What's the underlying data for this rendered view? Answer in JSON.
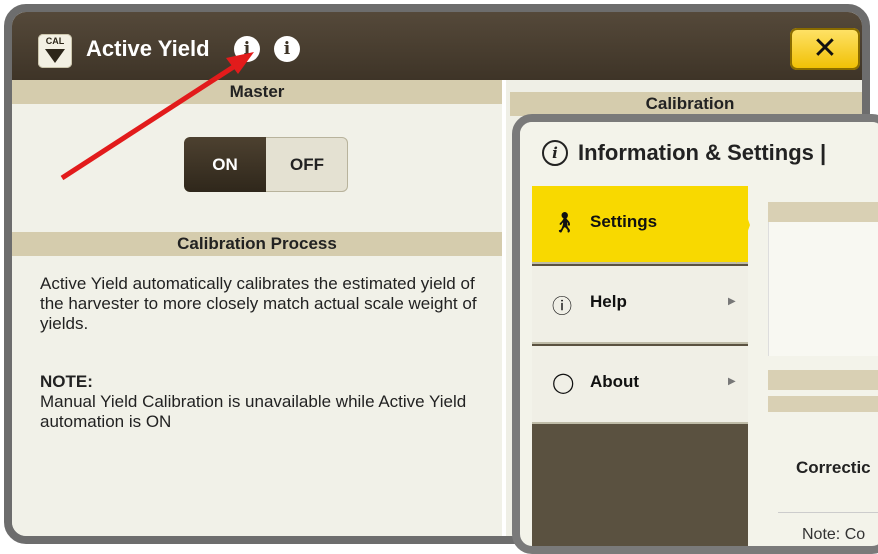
{
  "window": {
    "title": "Active Yield",
    "close_label": "✕",
    "cal_icon_text": "CAL"
  },
  "sections": {
    "master": "Master",
    "calibration": "Calibration",
    "calibration_process": "Calibration Process"
  },
  "toggle": {
    "on_label": "ON",
    "off_label": "OFF",
    "selected": "ON"
  },
  "calibration_process": {
    "description": "Active Yield automatically calibrates the estimated yield of the harvester to more closely match actual scale weight of yields.",
    "note_label": "NOTE:",
    "note_text": "Manual Yield Calibration is unavailable while Active Yield automation is ON"
  },
  "popup": {
    "title": "Information & Settings |",
    "nav": [
      {
        "label": "Settings",
        "icon": "person-icon",
        "active": true
      },
      {
        "label": "Help",
        "icon": "question-icon",
        "active": false
      },
      {
        "label": "About",
        "icon": "speech-bubble-icon",
        "active": false
      }
    ],
    "content": {
      "correction_text": "Correctic",
      "note_text": "Note: Co"
    }
  },
  "colors": {
    "titlebar": "#3e3427",
    "accent_yellow": "#f8d900",
    "section_header": "#d5ccad",
    "annotation_arrow": "#e21b1b"
  }
}
